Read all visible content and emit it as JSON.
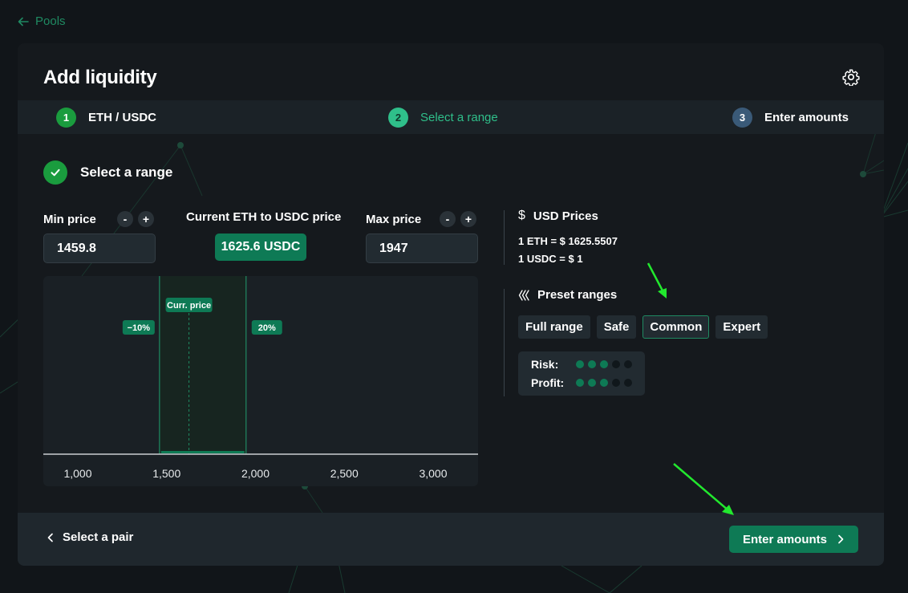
{
  "nav": {
    "back_label": "Pools"
  },
  "card": {
    "title": "Add liquidity"
  },
  "steps": [
    {
      "number": "1",
      "label": "ETH / USDC"
    },
    {
      "number": "2",
      "label": "Select a range"
    },
    {
      "number": "3",
      "label": "Enter amounts"
    }
  ],
  "section": {
    "title": "Select a range"
  },
  "range": {
    "min_label": "Min price",
    "min_value": "1459.8",
    "current_label": "Current ETH to USDC price",
    "current_value": "1625.6 USDC",
    "max_label": "Max price",
    "max_value": "1947",
    "minus": "-",
    "plus": "+"
  },
  "chart_data": {
    "type": "area",
    "x_ticks": [
      "1,000",
      "1,500",
      "2,000",
      "2,500",
      "3,000"
    ],
    "xlim": [
      800,
      3200
    ],
    "range_min": 1459.8,
    "range_max": 1947,
    "current_price": 1625.6,
    "current_label": "Curr. price",
    "min_pct_label": "−10%",
    "max_pct_label": "20%"
  },
  "usd_prices": {
    "title": "USD Prices",
    "eth_line": "1 ETH = $ 1625.5507",
    "usdc_line": "1 USDC = $ 1"
  },
  "presets": {
    "title": "Preset ranges",
    "options": [
      "Full range",
      "Safe",
      "Common",
      "Expert"
    ],
    "selected": "Common",
    "risk_label": "Risk:",
    "risk_level": 3,
    "profit_label": "Profit:",
    "profit_level": 3,
    "max_level": 5
  },
  "footer": {
    "prev_label": "Select a pair",
    "next_label": "Enter amounts"
  },
  "colors": {
    "accent": "#0e7a55",
    "accent_text": "#2fbf8a",
    "success": "#1a9c3e",
    "annotation_arrow": "#22e82e"
  }
}
